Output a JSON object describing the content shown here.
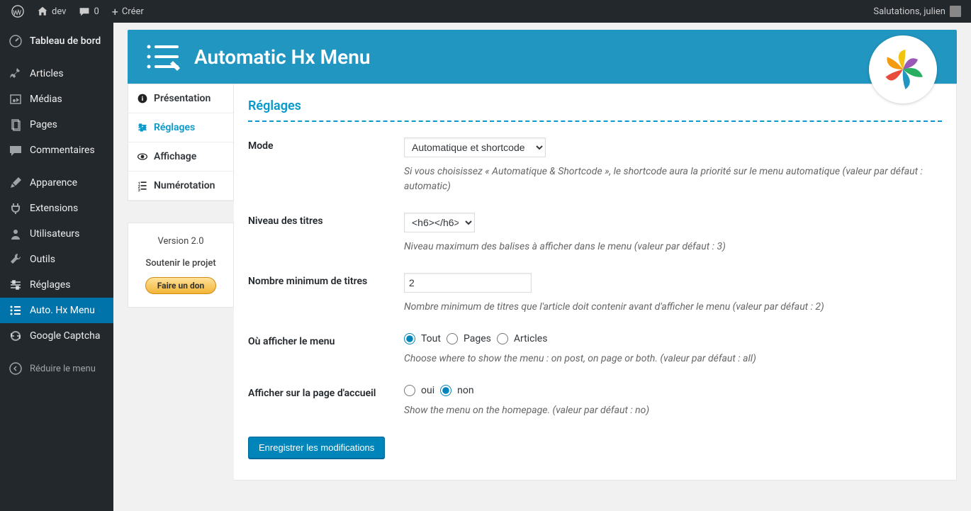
{
  "adminbar": {
    "site_name": "dev",
    "comment_count": "0",
    "create_label": "Créer",
    "greeting": "Salutations, julien"
  },
  "sidebar": [
    {
      "id": "dashboard",
      "label": "Tableau de bord",
      "icon": "dashboard",
      "bold": true
    },
    {
      "id": "sep",
      "sep": true
    },
    {
      "id": "posts",
      "label": "Articles",
      "icon": "pin"
    },
    {
      "id": "media",
      "label": "Médias",
      "icon": "media"
    },
    {
      "id": "pages",
      "label": "Pages",
      "icon": "pages"
    },
    {
      "id": "comments",
      "label": "Commentaires",
      "icon": "comment"
    },
    {
      "id": "sep2",
      "sep": true
    },
    {
      "id": "appearance",
      "label": "Apparence",
      "icon": "brush"
    },
    {
      "id": "plugins",
      "label": "Extensions",
      "icon": "plug"
    },
    {
      "id": "users",
      "label": "Utilisateurs",
      "icon": "user"
    },
    {
      "id": "tools",
      "label": "Outils",
      "icon": "wrench"
    },
    {
      "id": "settings",
      "label": "Réglages",
      "icon": "sliders"
    },
    {
      "id": "hxmenu",
      "label": "Auto. Hx Menu",
      "icon": "list",
      "active": true
    },
    {
      "id": "captcha",
      "label": "Google Captcha",
      "icon": "captcha"
    },
    {
      "id": "sep3",
      "sep": true
    },
    {
      "id": "collapse",
      "label": "Réduire le menu",
      "icon": "collapse",
      "collapse": true
    }
  ],
  "plugin": {
    "title": "Automatic Hx Menu"
  },
  "tabs": [
    {
      "id": "presentation",
      "label": "Présentation",
      "icon": "info"
    },
    {
      "id": "reglages",
      "label": "Réglages",
      "icon": "settings",
      "active": true
    },
    {
      "id": "affichage",
      "label": "Affichage",
      "icon": "eye"
    },
    {
      "id": "numerotation",
      "label": "Numérotation",
      "icon": "num"
    }
  ],
  "support": {
    "version": "Version 2.0",
    "soutenir": "Soutenir le projet",
    "donate": "Faire un don"
  },
  "section_title": "Réglages",
  "fields": {
    "mode": {
      "label": "Mode",
      "value": "Automatique et shortcode",
      "help": "Si vous choisissez « Automatique & Shortcode », le shortcode aura la priorité sur le menu automatique (valeur par défaut : automatic)"
    },
    "level": {
      "label": "Niveau des titres",
      "value": "<h6></h6>",
      "help": "Niveau maximum des balises à afficher dans le menu (valeur par défaut : 3)"
    },
    "min": {
      "label": "Nombre minimum de titres",
      "value": "2",
      "help": "Nombre minimum de titres que l'article doit contenir avant d'afficher le menu (valeur par défaut : 2)"
    },
    "where": {
      "label": "Où afficher le menu",
      "opt_all": "Tout",
      "opt_pages": "Pages",
      "opt_posts": "Articles",
      "help": "Choose where to show the menu : on post, on page or both. (valeur par défaut : all)"
    },
    "home": {
      "label": "Afficher sur la page d'accueil",
      "opt_yes": "oui",
      "opt_no": "non",
      "help": "Show the menu on the homepage. (valeur par défaut : no)"
    }
  },
  "submit_label": "Enregistrer les modifications"
}
